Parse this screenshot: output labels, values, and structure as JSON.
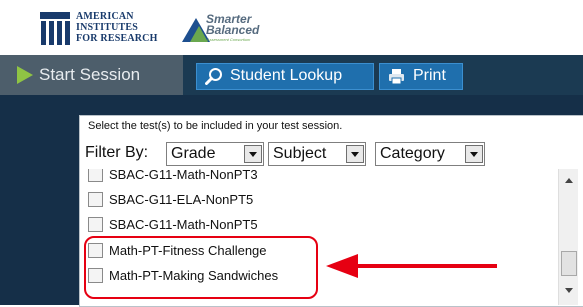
{
  "logos": {
    "air_line1": "AMERICAN",
    "air_line2": "INSTITUTES",
    "air_line3": "FOR RESEARCH",
    "sb_line1": "Smarter",
    "sb_line2": "Balanced",
    "sb_sub": "Assessment Consortium"
  },
  "toolbar": {
    "start_session": "Start Session",
    "student_lookup": "Student Lookup",
    "print": "Print"
  },
  "panel": {
    "instruction": "Select the test(s) to be included in your test session.",
    "filter_label": "Filter By:",
    "filters": [
      "Grade",
      "Subject",
      "Category"
    ],
    "tests": [
      {
        "name": "SBAC-G11-Math-NonPT3",
        "checked": false
      },
      {
        "name": "SBAC-G11-ELA-NonPT5",
        "checked": false
      },
      {
        "name": "SBAC-G11-Math-NonPT5",
        "checked": false
      },
      {
        "name": "Math-PT-Fitness Challenge",
        "checked": false
      },
      {
        "name": "Math-PT-Making Sandwiches",
        "checked": false
      }
    ]
  },
  "colors": {
    "toolbar_bg": "#1b3a52",
    "start_session_bg": "#4d5e6b",
    "button_blue": "#1f6fad",
    "highlight_red": "#e60012",
    "play_green": "#8fc444"
  },
  "icons": [
    "play-icon",
    "search-icon",
    "printer-icon"
  ]
}
